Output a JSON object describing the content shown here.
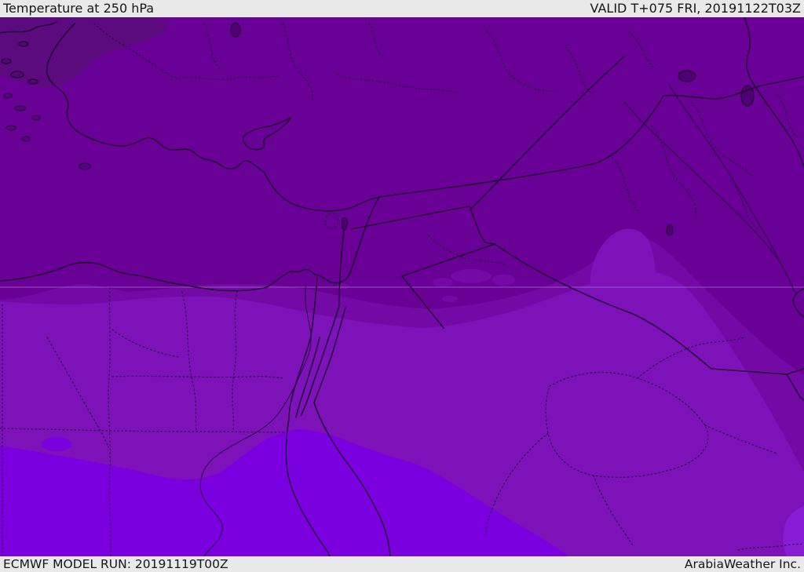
{
  "header": {
    "title": "Temperature at 250 hPa",
    "valid_label": "VALID T+075 FRI, 20191122T03Z"
  },
  "footer": {
    "model_run_label": "ECMWF MODEL RUN: 20191119T00Z",
    "credit_label": "ArabiaWeather Inc."
  },
  "map": {
    "parameter": "Temperature at 250 hPa",
    "model": "ECMWF",
    "run": "20191119T00Z",
    "valid_time": "20191122T03Z",
    "forecast_hour": "T+075",
    "region": "Middle East / Eastern Mediterranean",
    "temperature_bands": [
      {
        "name": "coldest-north",
        "color": "#5b0b7e"
      },
      {
        "name": "very-cold-upper",
        "color": "#690197"
      },
      {
        "name": "cold-transition-strip",
        "color": "#740aa5"
      },
      {
        "name": "mild-central",
        "color": "#7d12b8"
      },
      {
        "name": "warm-south",
        "color": "#7a00e0"
      },
      {
        "name": "warm-southeast-corner",
        "color": "#881bd4"
      }
    ],
    "bar_background": "#e9e9e9",
    "text_color": "#161616"
  }
}
